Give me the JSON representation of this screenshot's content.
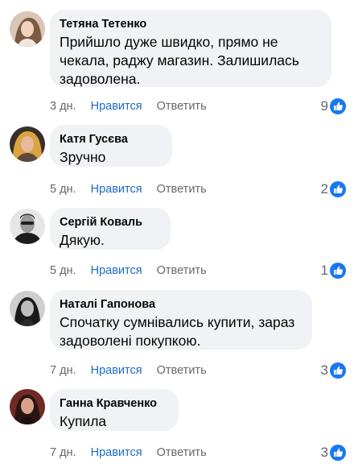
{
  "like_icon_color": "#1877f2",
  "link_color": "#1c69c7",
  "bubble_color": "#f0f2f5",
  "comments": [
    {
      "author": "Тетяна Тетенко",
      "text": "Прийшло дуже швидко, прямо не чекала, раджу магазин. Залишилась задоволена.",
      "time": "3 дн.",
      "like_label": "Нравится",
      "reply_label": "Ответить",
      "reactions": "9"
    },
    {
      "author": "Катя Гусєва",
      "text": "Зручно",
      "time": "5 дн.",
      "like_label": "Нравится",
      "reply_label": "Ответить",
      "reactions": "2"
    },
    {
      "author": "Сергій Коваль",
      "text": "Дякую.",
      "time": "5 дн.",
      "like_label": "Нравится",
      "reply_label": "Ответить",
      "reactions": "1"
    },
    {
      "author": "Наталі Гапонова",
      "text": "Спочатку сумнівались купити, зараз задоволені покупкою.",
      "time": "7 дн.",
      "like_label": "Нравится",
      "reply_label": "Ответить",
      "reactions": "3"
    },
    {
      "author": "Ганна Кравченко",
      "text": "Купила",
      "time": "7 дн.",
      "like_label": "Нравится",
      "reply_label": "Ответить",
      "reactions": "3"
    }
  ]
}
